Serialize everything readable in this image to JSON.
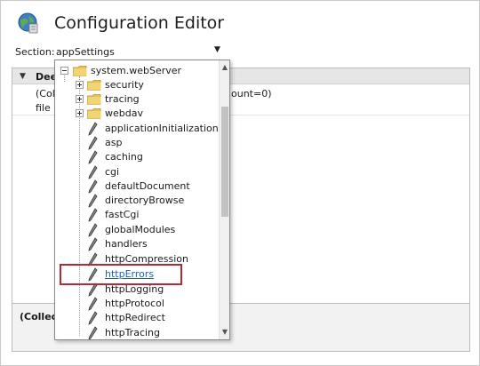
{
  "window": {
    "title": "Configuration Editor"
  },
  "section": {
    "label": "Section:",
    "value": "appSettings"
  },
  "grid": {
    "group": "Dee",
    "row1": "(Col",
    "row1_value": "ount=0)",
    "row2": "file"
  },
  "description": {
    "text": "(Collect"
  },
  "tree": {
    "root": "system.webServer",
    "folders": [
      "security",
      "tracing",
      "webdav"
    ],
    "items": [
      "applicationInitialization",
      "asp",
      "caching",
      "cgi",
      "defaultDocument",
      "directoryBrowse",
      "fastCgi",
      "globalModules",
      "handlers",
      "httpCompression",
      "httpErrors",
      "httpLogging",
      "httpProtocol",
      "httpRedirect",
      "httpTracing"
    ]
  },
  "icons": {
    "globe": "globe-icon",
    "folder": "folder-icon",
    "element": "config-element-icon",
    "dropdown": "chevron-down-icon"
  },
  "colors": {
    "link": "#1c5fb5",
    "highlight": "#b22a36",
    "folder": "#e8c35a"
  }
}
